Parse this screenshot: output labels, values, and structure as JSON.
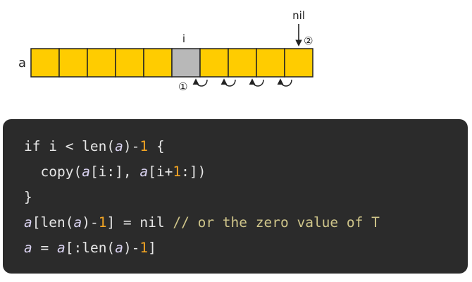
{
  "diagram": {
    "array_label": "a",
    "index_label": "i",
    "nil_label": "nil",
    "step_1": "①",
    "step_2": "②",
    "cell_count": 10,
    "highlight_index": 5,
    "colors": {
      "cell": "#ffcc00",
      "highlight": "#b8b8b8",
      "stroke": "#222222"
    }
  },
  "code": {
    "lines": [
      [
        {
          "t": "if i < len(",
          "c": "kw"
        },
        {
          "t": "a",
          "c": "var"
        },
        {
          "t": ")-",
          "c": "kw"
        },
        {
          "t": "1",
          "c": "num"
        },
        {
          "t": " {",
          "c": "kw"
        }
      ],
      [
        {
          "t": "  copy(",
          "c": "kw"
        },
        {
          "t": "a",
          "c": "var"
        },
        {
          "t": "[i:], ",
          "c": "kw"
        },
        {
          "t": "a",
          "c": "var"
        },
        {
          "t": "[i+",
          "c": "kw"
        },
        {
          "t": "1",
          "c": "num"
        },
        {
          "t": ":])",
          "c": "kw"
        }
      ],
      [
        {
          "t": "}",
          "c": "kw"
        }
      ],
      [
        {
          "t": "a",
          "c": "var"
        },
        {
          "t": "[len(",
          "c": "kw"
        },
        {
          "t": "a",
          "c": "var"
        },
        {
          "t": ")-",
          "c": "kw"
        },
        {
          "t": "1",
          "c": "num"
        },
        {
          "t": "] = nil ",
          "c": "kw"
        },
        {
          "t": "// or the zero value of T",
          "c": "cm"
        }
      ],
      [
        {
          "t": "a",
          "c": "var"
        },
        {
          "t": " = ",
          "c": "kw"
        },
        {
          "t": "a",
          "c": "var"
        },
        {
          "t": "[:len(",
          "c": "kw"
        },
        {
          "t": "a",
          "c": "var"
        },
        {
          "t": ")-",
          "c": "kw"
        },
        {
          "t": "1",
          "c": "num"
        },
        {
          "t": "]",
          "c": "kw"
        }
      ]
    ]
  }
}
